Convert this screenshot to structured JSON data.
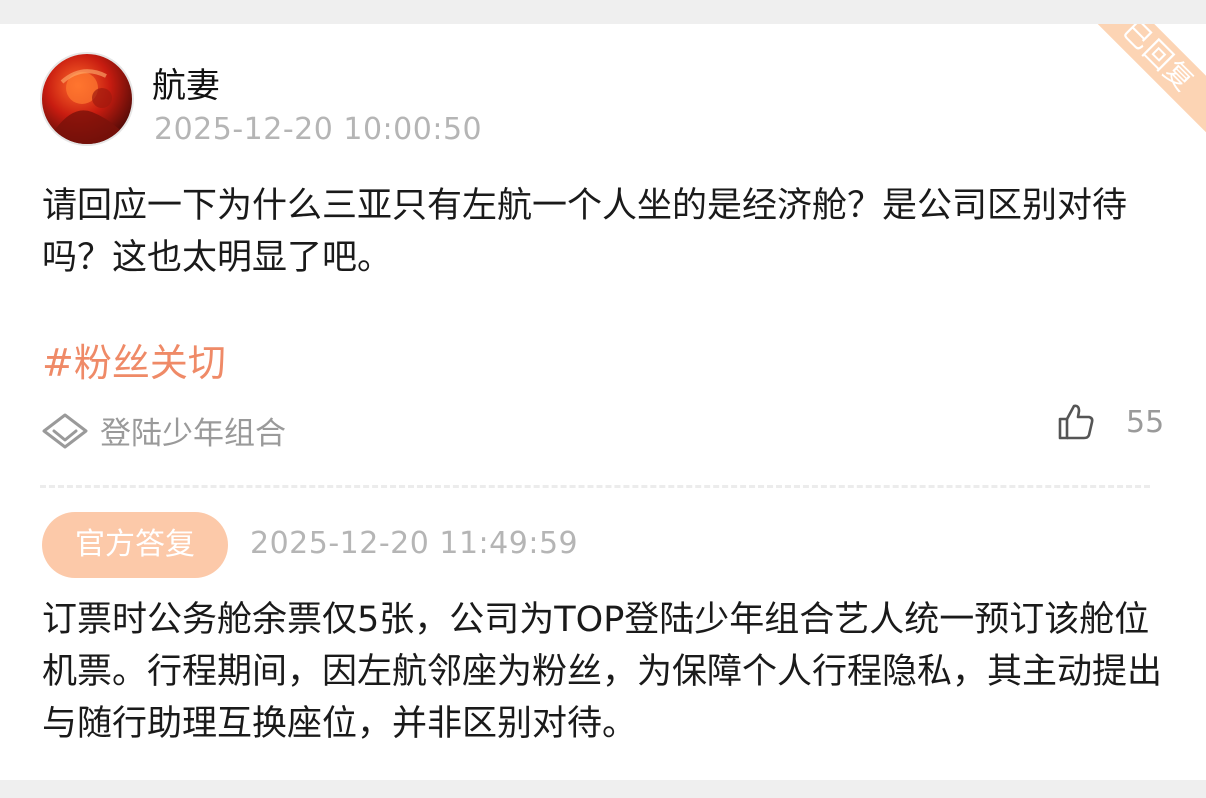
{
  "question": {
    "username": "航妻",
    "timestamp": "2025-12-20 10:00:50",
    "text": "请回应一下为什么三亚只有左航一个人坐的是经济舱？是公司区别对待吗？这也太明显了吧。",
    "hashtag": "#粉丝关切",
    "group_label": "登陆少年组合",
    "like_count": "55",
    "status_ribbon": "已回复"
  },
  "answer": {
    "badge_label": "官方答复",
    "timestamp": "2025-12-20 11:49:59",
    "text": "订票时公务舱余票仅5张，公司为TOP登陆少年组合艺人统一预订该舱位机票。行程期间，因左航邻座为粉丝，为保障个人行程隐私，其主动提出与随行助理互换座位，并非区别对待。"
  },
  "icons": {
    "group": "diamond-outline-icon",
    "like": "thumbs-up-outline-icon"
  },
  "colors": {
    "hashtag": "#ef8a67",
    "badge_bg": "#fcc9a9",
    "ribbon_bg": "#fcd4b4",
    "muted_text": "#b5b5b5"
  }
}
